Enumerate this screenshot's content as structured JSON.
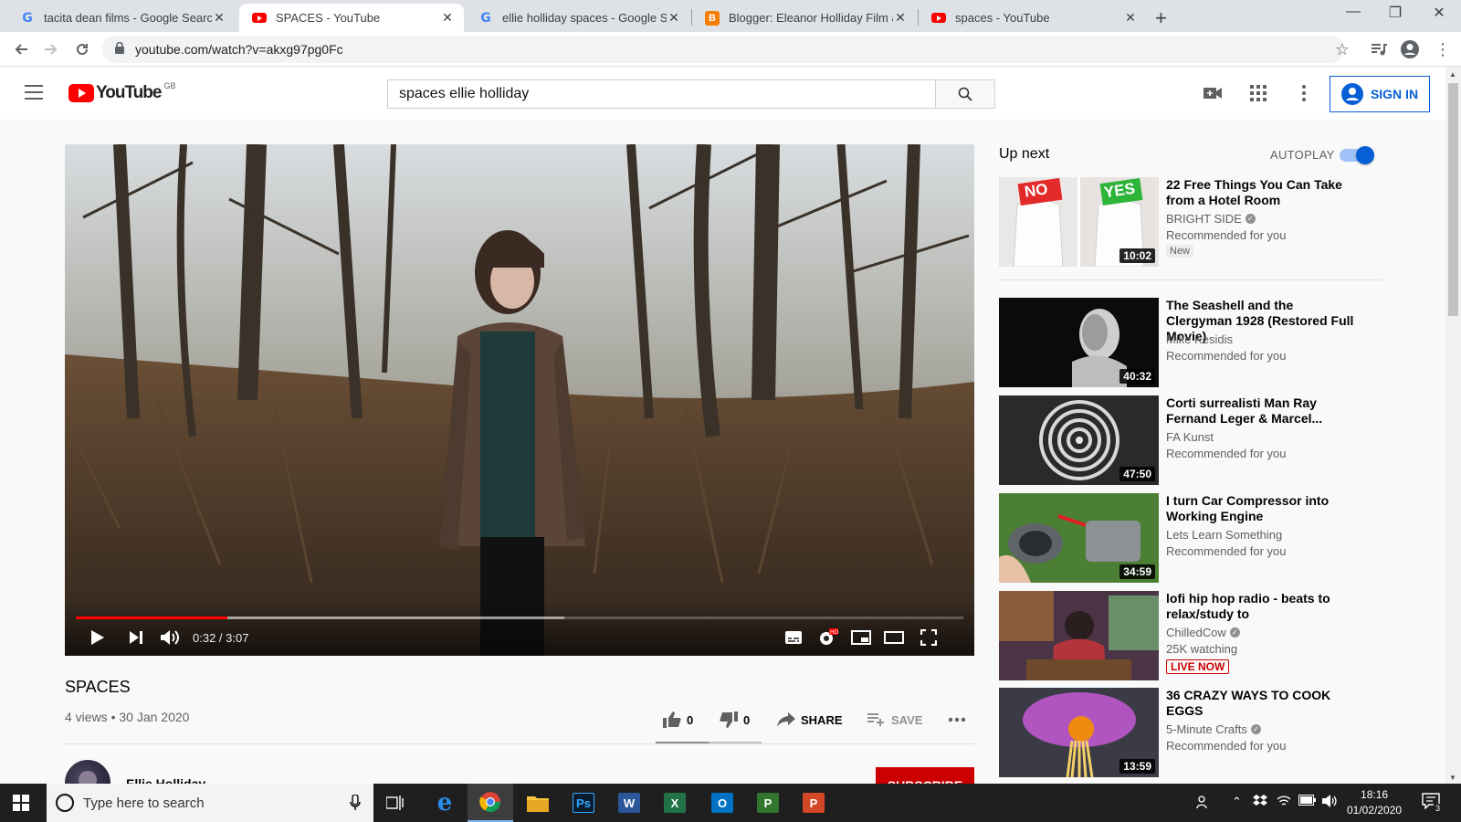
{
  "browser": {
    "tabs": [
      {
        "title": "tacita dean films - Google Search",
        "favicon": "google-icon",
        "active": false
      },
      {
        "title": "SPACES - YouTube",
        "favicon": "youtube-icon",
        "active": true
      },
      {
        "title": "ellie holliday spaces - Google Search",
        "favicon": "google-icon",
        "active": false
      },
      {
        "title": "Blogger: Eleanor Holliday Film and",
        "favicon": "blogger-icon",
        "active": false
      },
      {
        "title": "spaces - YouTube",
        "favicon": "youtube-icon",
        "active": false
      }
    ],
    "url": "youtube.com/watch?v=akxg97pg0Fc"
  },
  "header": {
    "logo_text": "YouTube",
    "region": "GB",
    "search_value": "spaces ellie holliday",
    "sign_in": "SIGN IN"
  },
  "player": {
    "time": "0:32 / 3:07",
    "progress_fraction": 0.171,
    "buffered_fraction": 0.55
  },
  "video": {
    "title": "SPACES",
    "meta": "4 views • 30 Jan 2020",
    "likes": "0",
    "dislikes": "0",
    "share": "SHARE",
    "save": "SAVE",
    "like_fraction": 0.5,
    "owner": "Ellie Holliday",
    "subscribe": "SUBSCRIBE"
  },
  "sidebar": {
    "up_next": "Up next",
    "autoplay": "AUTOPLAY",
    "items": [
      {
        "title": "22 Free Things You Can Take from a Hotel Room",
        "channel": "BRIGHT SIDE",
        "verified": true,
        "info": "Recommended for you",
        "badge": "New",
        "duration": "10:02",
        "thumb_no": "NO",
        "thumb_yes": "YES"
      },
      {
        "title": "The Seashell and the Clergyman 1928 (Restored Full Movie)",
        "channel": "Mike Kesidis",
        "verified": false,
        "info": "Recommended for you",
        "duration": "40:32"
      },
      {
        "title": "Corti surrealisti Man Ray Fernand Leger & Marcel...",
        "channel": "FA Kunst",
        "verified": false,
        "info": "Recommended for you",
        "duration": "47:50"
      },
      {
        "title": "I turn Car Compressor into Working Engine",
        "channel": "Lets Learn Something",
        "verified": false,
        "info": "Recommended for you",
        "duration": "34:59"
      },
      {
        "title": "lofi hip hop radio - beats to relax/study to",
        "channel": "ChilledCow",
        "verified": true,
        "info": "25K watching",
        "badge": "LIVE NOW"
      },
      {
        "title": "36 CRAZY WAYS TO COOK EGGS",
        "channel": "5-Minute Crafts",
        "verified": true,
        "info": "Recommended for you",
        "duration": "13:59"
      }
    ]
  },
  "taskbar": {
    "search_placeholder": "Type here to search",
    "time": "18:16",
    "date": "01/02/2020",
    "notifications": "3"
  },
  "colors": {
    "yt_red": "#ff0000",
    "link_blue": "#065fd4",
    "subscribe_red": "#cc0000"
  }
}
